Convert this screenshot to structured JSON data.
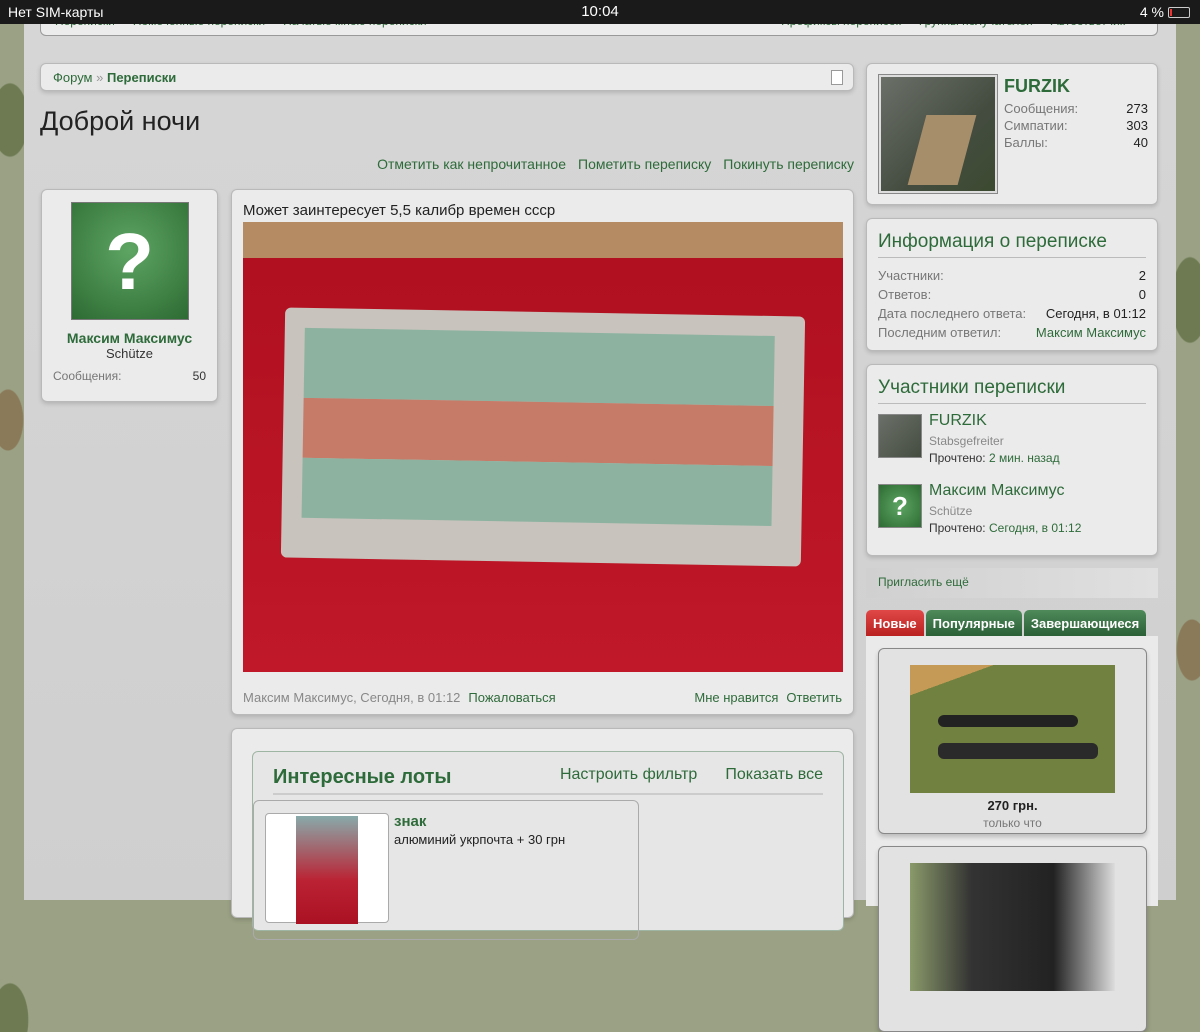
{
  "statusbar": {
    "carrier": "Нет SIM-карты",
    "time": "10:04",
    "battery": "4 %"
  },
  "topnav": {
    "left": [
      "Переписки",
      "Помеченные переписки",
      "Начатые мною переписки"
    ],
    "right": [
      "Префиксы переписок",
      "Группы получателей",
      "Автоответчик"
    ]
  },
  "breadcrumb": {
    "home": "Форум",
    "sep": "»",
    "current": "Переписки"
  },
  "title": "Доброй ночи",
  "actions": [
    "Отметить как непрочитанное",
    "Пометить переписку",
    "Покинуть переписку"
  ],
  "author": {
    "name": "Максим Максимус",
    "rank": "Schütze",
    "stat_label": "Сообщения:",
    "stat_value": "50",
    "avatar": "?"
  },
  "post": {
    "text": "Может заинтересует 5,5 калибр времен ссср",
    "meta": "Максим Максимус, Сегодня, в 01:12",
    "report": "Пожаловаться",
    "like": "Мне нравится",
    "reply": "Ответить"
  },
  "lots": {
    "title": "Интересные лоты",
    "filter": "Настроить фильтр",
    "show_all": "Показать все",
    "items": [
      {
        "title": "знак",
        "desc": "алюминий укрпочта + 30 грн"
      }
    ]
  },
  "profile": {
    "name": "FURZIK",
    "stats": [
      {
        "label": "Сообщения:",
        "value": "273"
      },
      {
        "label": "Симпатии:",
        "value": "303"
      },
      {
        "label": "Баллы:",
        "value": "40"
      }
    ]
  },
  "info": {
    "title": "Информация о переписке",
    "rows": [
      {
        "label": "Участники:",
        "value": "2"
      },
      {
        "label": "Ответов:",
        "value": "0"
      },
      {
        "label": "Дата последнего ответа:",
        "value": "Сегодня, в 01:12"
      },
      {
        "label": "Последним ответил:",
        "value": "Максим Максимус"
      }
    ]
  },
  "participants": {
    "title": "Участники переписки",
    "items": [
      {
        "name": "FURZIK",
        "rank": "Stabsgefreiter",
        "read_label": "Прочтено:",
        "read": "2 мин. назад"
      },
      {
        "name": "Максим Максимус",
        "rank": "Schütze",
        "read_label": "Прочтено:",
        "read": "Сегодня, в 01:12",
        "avatar": "?"
      }
    ]
  },
  "invite": "Пригласить ещё",
  "tabs": [
    "Новые",
    "Популярные",
    "Завершающиеся"
  ],
  "cards": [
    {
      "price": "270 грн.",
      "when": "только что"
    }
  ]
}
